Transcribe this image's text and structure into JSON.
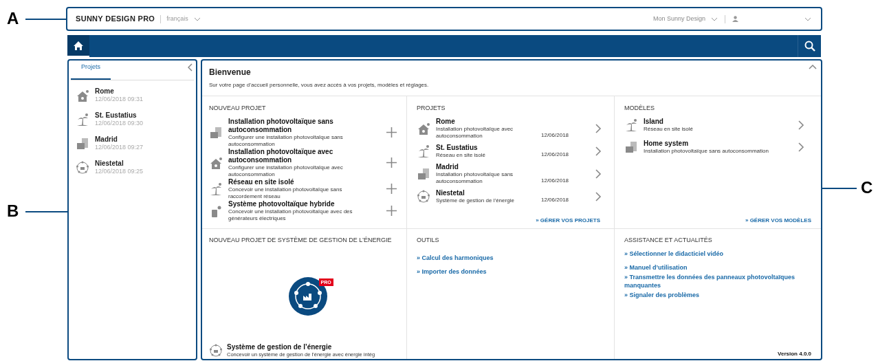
{
  "callouts": [
    {
      "label": "A"
    },
    {
      "label": "B"
    },
    {
      "label": "C"
    }
  ],
  "header": {
    "brand": "SUNNY DESIGN PRO",
    "language": "français",
    "menu": "Mon Sunny Design"
  },
  "sidebar": {
    "tabs": [
      {
        "label": "Projets",
        "selected": true
      }
    ],
    "items": [
      {
        "kind": "house",
        "name": "Rome",
        "date": "12/06/2018 09:31"
      },
      {
        "kind": "island",
        "name": "St. Eustatius",
        "date": "12/06/2018 09:30"
      },
      {
        "kind": "panels",
        "name": "Madrid",
        "date": "12/06/2018 09:27"
      },
      {
        "kind": "energy",
        "name": "Niestetal",
        "date": "12/06/2018 09:25"
      }
    ]
  },
  "welcome": {
    "title": "Bienvenue",
    "text": "Sur votre page d’accueil personnelle, vous avez accès à vos projets, modèles et réglages."
  },
  "new_project": {
    "heading": "NOUVEAU PROJET",
    "items": [
      {
        "kind": "panels",
        "title": "Installation photovoltaïque sans autoconsommation",
        "description": "Configurer une installation photovoltaïque sans autoconsommation"
      },
      {
        "kind": "house",
        "title": "Installation photovoltaïque avec autoconsommation",
        "description": "Configurer une installation photovoltaïque avec autoconsommation"
      },
      {
        "kind": "island",
        "title": "Réseau en site isolé",
        "description": "Concevoir une installation photovoltaïque sans raccordement réseau"
      },
      {
        "kind": "hybrid",
        "title": "Système photovoltaïque hybride",
        "description": "Concevoir une installation photovoltaïque avec des générateurs électriques"
      }
    ]
  },
  "projects": {
    "heading": "PROJETS",
    "items": [
      {
        "kind": "house",
        "name": "Rome",
        "description": "Installation photovoltaïque avec autoconsommation",
        "date": "12/06/2018"
      },
      {
        "kind": "island",
        "name": "St. Eustatius",
        "description": "Réseau en site isolé",
        "date": "12/06/2018"
      },
      {
        "kind": "panels",
        "name": "Madrid",
        "description": "Installation photovoltaïque sans autoconsommation",
        "date": "12/06/2018"
      },
      {
        "kind": "energy",
        "name": "Niestetal",
        "description": "Système de gestion de l’énergie",
        "date": "12/06/2018"
      }
    ],
    "link": "» GÉRER VOS PROJETS"
  },
  "models": {
    "heading": "MODÈLES",
    "items": [
      {
        "kind": "island",
        "name": "Island",
        "description": "Réseau en site isolé"
      },
      {
        "kind": "panels",
        "name": "Home system",
        "description": "Installation photovoltaïque sans autoconsommation"
      }
    ],
    "link": "» GÉRER VOS MODÈLES"
  },
  "energy_project": {
    "heading": "NOUVEAU PROJET DE SYSTÈME DE GESTION DE L’ÉNERGIE",
    "badge": "PRO",
    "item": {
      "kind": "energy",
      "title": "Système de gestion de l’énergie",
      "description": "Concevoir un système de gestion de l’énergie avec énergie intég"
    }
  },
  "tools": {
    "heading": "OUTILS",
    "links": [
      "» Calcul des harmoniques",
      "» Importer des données"
    ]
  },
  "support": {
    "heading": "ASSISTANCE ET ACTUALITÉS",
    "links": [
      "» Sélectionner le didacticiel vidéo",
      "» Manuel d’utilisation",
      "» Transmettre les données des panneaux photovoltaïques manquantes",
      "» Signaler des problèmes"
    ],
    "version": "Version 4.0.0"
  }
}
